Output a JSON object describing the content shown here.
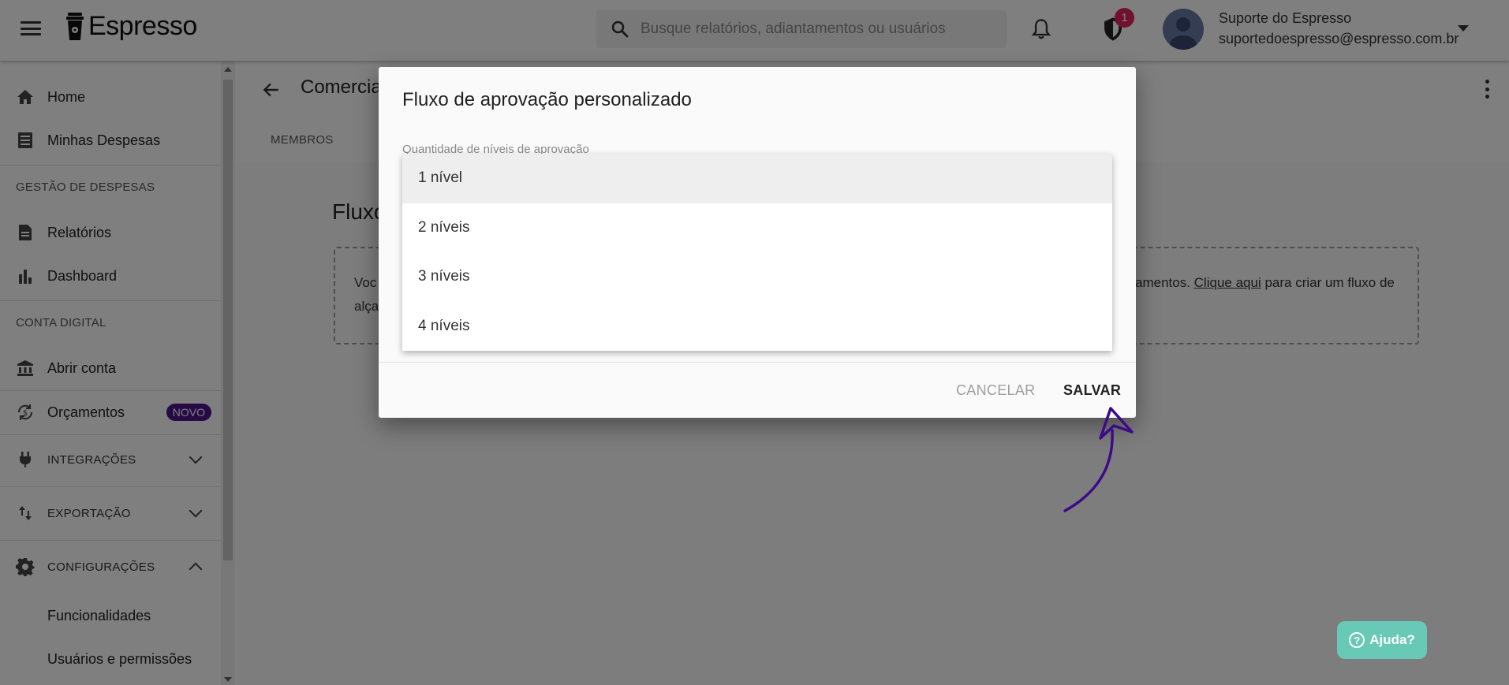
{
  "app": {
    "brand": "Espresso"
  },
  "search": {
    "placeholder": "Busque relatórios, adiantamentos ou usuários"
  },
  "notifications": {
    "shield_badge": "1"
  },
  "user": {
    "name": "Suporte do Espresso",
    "email": "suportedoespresso@espresso.com.br"
  },
  "sidebar": {
    "home": "Home",
    "minhas_despesas": "Minhas Despesas",
    "section_gestao": "GESTÃO DE DESPESAS",
    "relatorios": "Relatórios",
    "dashboard": "Dashboard",
    "section_conta": "CONTA DIGITAL",
    "abrir_conta": "Abrir conta",
    "orcamentos": "Orçamentos",
    "novo_badge": "NOVO",
    "integracoes": "INTEGRAÇÕES",
    "exportacao": "EXPORTAÇÃO",
    "configuracoes": "CONFIGURAÇÕES",
    "funcionalidades": "Funcionalidades",
    "usuarios_permissoes": "Usuários e permissões"
  },
  "page": {
    "title": "Comercial",
    "tab_membros": "MEMBROS",
    "content_title": "Fluxo",
    "box_text_1": "Voc",
    "box_text_2": "alça",
    "box_right_prefix": "amentos. ",
    "box_link": "Clique aqui",
    "box_right_suffix": " para criar um fluxo de"
  },
  "dialog": {
    "title": "Fluxo de aprovação personalizado",
    "field_label": "Quantidade de níveis de aprovação",
    "options": [
      "1 nível",
      "2 níveis",
      "3 níveis",
      "4 níveis"
    ],
    "selected_index": 0,
    "cancel": "CANCELAR",
    "save": "SALVAR"
  },
  "help": {
    "label": "Ajuda?"
  },
  "colors": {
    "accent": "#4a148c",
    "badge": "#e0245e",
    "help": "#68c9b6",
    "annotation": "#3d0a8a"
  }
}
